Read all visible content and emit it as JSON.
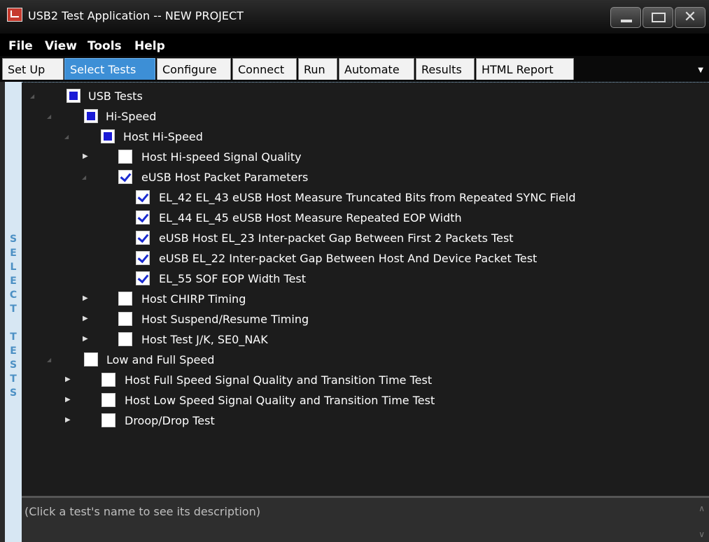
{
  "window": {
    "title": "USB2 Test Application -- NEW PROJECT"
  },
  "menu": [
    "File",
    "View",
    "Tools",
    "Help"
  ],
  "tabs": [
    {
      "label": "Set Up",
      "active": false
    },
    {
      "label": "Select Tests",
      "active": true
    },
    {
      "label": "Configure",
      "active": false
    },
    {
      "label": "Connect",
      "active": false
    },
    {
      "label": "Run",
      "active": false
    },
    {
      "label": "Automate",
      "active": false
    },
    {
      "label": "Results",
      "active": false
    },
    {
      "label": "HTML Report",
      "active": false
    }
  ],
  "side_rail": {
    "label": "SELECT TESTS"
  },
  "tree": {
    "usb_tests": "USB Tests",
    "hi_speed": "Hi-Speed",
    "host_hi_speed": "Host Hi-Speed",
    "host_hs_signal_quality": "Host Hi-speed Signal Quality",
    "eusb_host_packet_params": "eUSB Host Packet Parameters",
    "el42_el43": "EL_42 EL_43 eUSB Host Measure Truncated Bits from Repeated SYNC Field",
    "el44_el45": "EL_44 EL_45 eUSB Host Measure Repeated EOP Width",
    "el23": "eUSB Host EL_23 Inter-packet Gap Between First 2 Packets Test",
    "el22": "eUSB EL_22 Inter-packet Gap Between Host And Device Packet Test",
    "el55": "EL_55 SOF EOP Width Test",
    "host_chirp": "Host CHIRP Timing",
    "host_suspend": "Host Suspend/Resume Timing",
    "host_test_jk": "Host Test J/K, SE0_NAK",
    "low_full_speed": "Low and Full Speed",
    "host_fs_signal": "Host Full Speed Signal Quality and Transition Time Test",
    "host_ls_signal": "Host Low Speed Signal Quality and Transition Time Test",
    "droop_drop": "Droop/Drop Test"
  },
  "description": {
    "text": "(Click a test's name to see its description)"
  }
}
